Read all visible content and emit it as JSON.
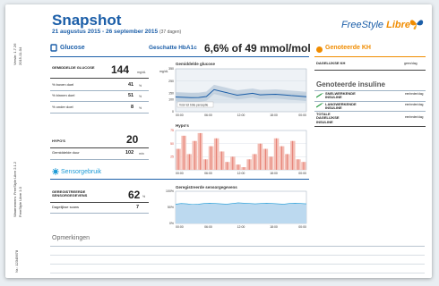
{
  "header": {
    "title": "Snapshot",
    "date_range": "21 augustus 2015 - 26 september 2015",
    "days": "(37 dagen)",
    "brand": "FreeStyle",
    "brand_libre": "Libre",
    "hba1c_label": "Geschatte HbA1c",
    "hba1c_value": "6,6% of 49 mmol/mol"
  },
  "margin": {
    "version": "Versie: 1.7.26",
    "date": "2015-11-04",
    "device": "Waarnemers: FreeStyle Libre 2.1.2",
    "device_sub": "FreeStyle Libre 1.0",
    "serial": "Nr.: 12345678"
  },
  "glucose": {
    "heading": "Glucose",
    "avg_label": "GEMIDDELDE GLUCOSE",
    "avg_value": "144",
    "avg_unit": "mg/dL",
    "rows": [
      {
        "label": "% boven doel",
        "value": "41",
        "unit": "%"
      },
      {
        "label": "% binnen doel",
        "value": "51",
        "unit": "%"
      },
      {
        "label": "% onder doel",
        "value": "8",
        "unit": "%"
      }
    ],
    "hypo_label": "HYPO'S",
    "hypo_value": "20",
    "hypo_dur_label": "Gemiddelde duur",
    "hypo_dur_value": "102",
    "hypo_dur_unit": "min"
  },
  "sensor": {
    "heading": "Sensorgebruik",
    "reg_label": "GEREGISTREERDE SENSORGEGEVENS",
    "reg_value": "62",
    "reg_unit": "%",
    "scans_label": "Dagelijkse scans",
    "scans_value": "7"
  },
  "charts_text": {
    "avg_title": "Gemiddelde glucose",
    "hypo_title": "Hypo's",
    "sensor_title": "Geregistreerde sensorgegevens",
    "avg_unit": "mg/dL",
    "target_label": "Vóór tot bôte perceptie",
    "x_ticks": [
      "00:00",
      "06:00",
      "12:00",
      "18:00",
      "00:00"
    ]
  },
  "right": {
    "kh_heading": "Genoteerde KH",
    "kh_label": "DAGELIJKSE KH",
    "kh_value": "geen/dag",
    "ins_heading": "Genoteerde insuline",
    "ins_rows": [
      {
        "label": "Snelwerkende insuline",
        "value": "eenheden/dag"
      },
      {
        "label": "Langwerkende insuline",
        "value": "eenheden/dag"
      },
      {
        "label": "TOTALE DAGELIJKSE INSULINE",
        "value": "eenheden/dag"
      }
    ]
  },
  "notes": {
    "heading": "Opmerkingen"
  },
  "colors": {
    "accent": "#1b5ea8",
    "orange": "#f08c00",
    "hypo": "#d9473a",
    "hypo_fill": "#f3bdb4"
  },
  "chart_data": [
    {
      "type": "line",
      "title": "Gemiddelde glucose",
      "ylabel": "mg/dL",
      "ylim": [
        0,
        350
      ],
      "yticks": [
        0,
        100,
        150,
        250,
        350
      ],
      "x": [
        "00:00",
        "06:00",
        "12:00",
        "18:00",
        "00:00"
      ],
      "series": [
        {
          "values": [
            120,
            118,
            115,
            116,
            124,
            180,
            165,
            150,
            135,
            142,
            150,
            138,
            140,
            142,
            138,
            132,
            128,
            122
          ]
        }
      ]
    },
    {
      "type": "bar",
      "title": "Hypo's",
      "ylim": [
        0,
        75
      ],
      "yticks": [
        25,
        50,
        75
      ],
      "x": [
        "00:00",
        "06:00",
        "12:00",
        "18:00",
        "00:00"
      ],
      "values": [
        40,
        65,
        30,
        55,
        70,
        20,
        45,
        60,
        35,
        15,
        25,
        10,
        5,
        20,
        30,
        50,
        40,
        25,
        60,
        45,
        30,
        55,
        20,
        15
      ]
    },
    {
      "type": "area",
      "title": "Geregistreerde sensorgegevens",
      "ylim": [
        0,
        100
      ],
      "yticks": [
        0,
        50,
        100
      ],
      "x": [
        "00:00",
        "06:00",
        "12:00",
        "18:00",
        "00:00"
      ],
      "values": [
        60,
        62,
        61,
        59,
        60,
        62,
        63,
        62,
        61,
        60,
        62,
        64,
        63,
        62,
        61,
        62,
        63,
        62,
        61,
        60,
        62,
        63,
        62,
        61
      ]
    }
  ]
}
